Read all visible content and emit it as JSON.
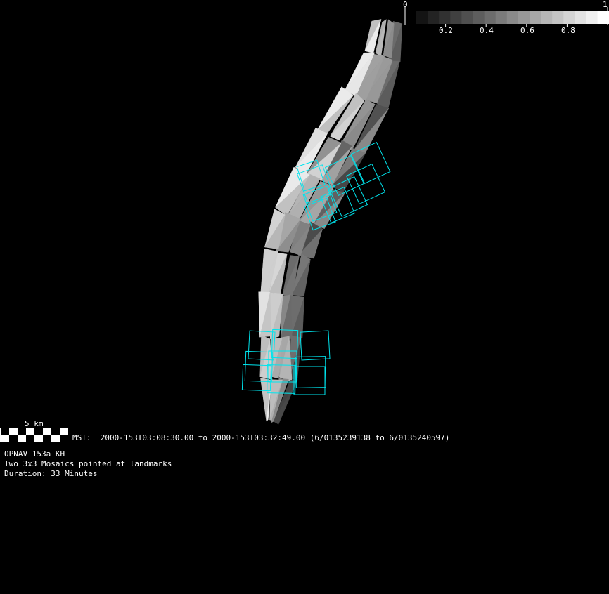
{
  "colorbar": {
    "min_label": "0",
    "max_label": "1",
    "ticks": [
      "0.2",
      "0.4",
      "0.6",
      "0.8"
    ],
    "tick_values": [
      0.2,
      0.4,
      0.6,
      0.8
    ],
    "segments": 17
  },
  "scale_bar": {
    "label": "5 km"
  },
  "msi_line": "MSI:  2000-153T03:08:30.00 to 2000-153T03:32:49.00 (6/0135239138 to 6/0135240597)",
  "info": [
    "OPNAV 153a KH",
    "Two 3x3 Mosaics pointed at landmarks",
    "Duration: 33 Minutes"
  ],
  "colors": {
    "footprint": "#00e5ee",
    "background": "#000000"
  }
}
